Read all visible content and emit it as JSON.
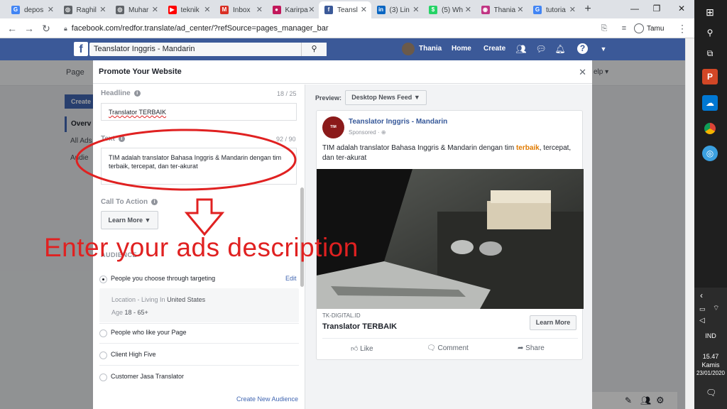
{
  "tabs": [
    {
      "label": "depos",
      "icon": "google-icon",
      "color": "#4285f4",
      "glyph": "G"
    },
    {
      "label": "Raghil",
      "icon": "globe-icon",
      "color": "#5f6368",
      "glyph": "◎"
    },
    {
      "label": "Muhar",
      "icon": "globe-icon",
      "color": "#5f6368",
      "glyph": "◎"
    },
    {
      "label": "teknik",
      "icon": "youtube-icon",
      "color": "#ff0000",
      "glyph": "▶"
    },
    {
      "label": "Inbox",
      "icon": "gmail-icon",
      "color": "#d93025",
      "glyph": "M"
    },
    {
      "label": "Karirpa",
      "icon": "karir-icon",
      "color": "#c2185b",
      "glyph": "●"
    },
    {
      "label": "Teansl",
      "icon": "facebook-icon",
      "color": "#3b5998",
      "glyph": "f"
    },
    {
      "label": "(3) Lin",
      "icon": "linkedin-icon",
      "color": "#0a66c2",
      "glyph": "in"
    },
    {
      "label": "(5) Wh",
      "icon": "whatsapp-icon",
      "color": "#25d366",
      "glyph": "$"
    },
    {
      "label": "Thania",
      "icon": "instagram-icon",
      "color": "#c13584",
      "glyph": "◉"
    },
    {
      "label": "tutoria",
      "icon": "google-icon",
      "color": "#4285f4",
      "glyph": "G"
    }
  ],
  "browser": {
    "url": "facebook.com/redfor.translate/ad_center/?refSource=pages_manager_bar",
    "profile": "Tamu"
  },
  "fb": {
    "search": "Teanslator Inggris - Mandarin",
    "user": "Thania",
    "home": "Home",
    "create": "Create",
    "page_tab": "Page",
    "help": "elp ▾"
  },
  "left_nav": {
    "create": "Create",
    "overview": "Overv",
    "all_ads": "All Ads",
    "audiences": "Audie"
  },
  "modal": {
    "title": "Promote Your Website",
    "headline_label": "Headline",
    "headline_count": "18 / 25",
    "headline_value": "Translator TERBAIK",
    "text_label": "Text",
    "text_count": "92 / 90",
    "text_value": "TIM adalah translator Bahasa Inggris & Mandarin dengan tim terbaik, tercepat, dan ter-akurat",
    "cta_label": "Call To Action",
    "cta_value": "Learn More",
    "audience_label": "AUDIENCE",
    "audience_options": [
      {
        "label": "People you choose through targeting",
        "selected": true
      },
      {
        "label": "People who like your Page",
        "selected": false
      },
      {
        "label": "Client High Five",
        "selected": false
      },
      {
        "label": "Customer Jasa Translator",
        "selected": false
      }
    ],
    "edit": "Edit",
    "location_label": "Location - Living In",
    "location_value": "United States",
    "age_label": "Age",
    "age_value": "18 - 65+",
    "create_audience": "Create New Audience"
  },
  "preview": {
    "label": "Preview:",
    "placement": "Desktop News Feed",
    "page_name": "Teanslator Inggris - Mandarin",
    "sponsored": "Sponsored",
    "text_start": "TIM adalah translator Bahasa Inggris & Mandarin dengan tim ",
    "text_highlight": "terbaik",
    "text_end": ", tercepat, dan ter-akurat",
    "domain": "TK-DIGITAL.ID",
    "headline": "Translator TERBAIK",
    "cta": "Learn More",
    "like": "Like",
    "comment": "Comment",
    "share": "Share"
  },
  "annotation": "Enter your ads description",
  "taskbar": {
    "lang": "IND",
    "time": "15.47",
    "day": "Kamis",
    "date": "23/01/2020"
  }
}
